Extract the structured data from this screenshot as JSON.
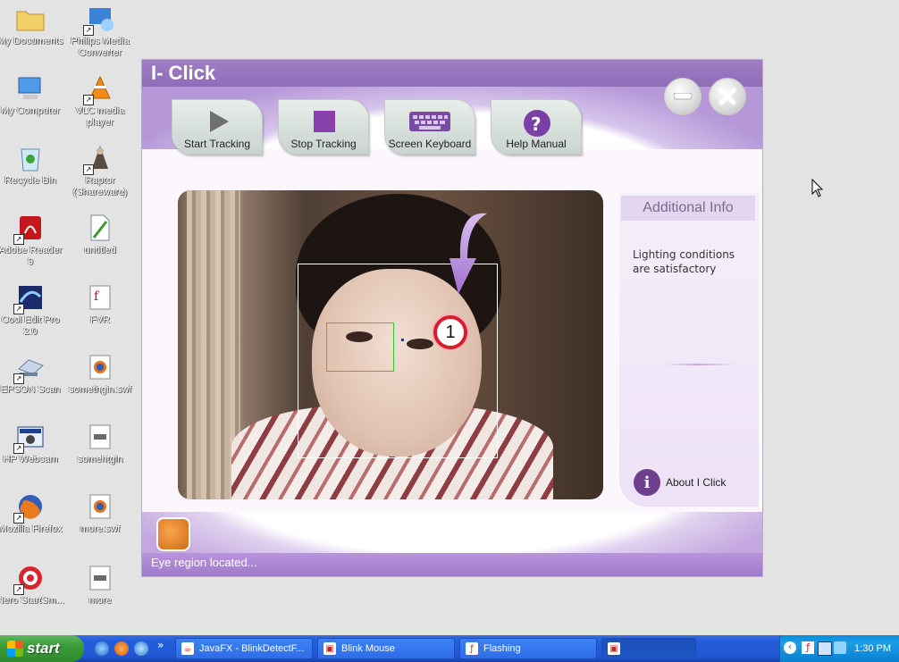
{
  "desktop": {
    "icons": [
      {
        "label": "My Documents",
        "icon": "folder-icon"
      },
      {
        "label": "Philips Media Converter",
        "icon": "media-converter-icon"
      },
      {
        "label": "My Computer",
        "icon": "computer-icon"
      },
      {
        "label": "VLC media player",
        "icon": "vlc-cone-icon"
      },
      {
        "label": "Recycle Bin",
        "icon": "recycle-bin-icon"
      },
      {
        "label": "Raptor (Shareware)",
        "icon": "raptor-icon"
      },
      {
        "label": "Adobe Reader 9",
        "icon": "adobe-reader-icon"
      },
      {
        "label": "untitled",
        "icon": "document-icon"
      },
      {
        "label": "Cool Edit Pro 2.0",
        "icon": "cool-edit-icon"
      },
      {
        "label": "FVR",
        "icon": "fvr-icon"
      },
      {
        "label": "EPSON Scan",
        "icon": "scanner-icon"
      },
      {
        "label": "somethgin.swf",
        "icon": "firefox-file-icon"
      },
      {
        "label": "HP Webcam",
        "icon": "webcam-icon"
      },
      {
        "label": "somehtgin",
        "icon": "html-file-icon"
      },
      {
        "label": "Mozilla Firefox",
        "icon": "firefox-icon"
      },
      {
        "label": "more.swf",
        "icon": "firefox-file-icon"
      },
      {
        "label": "Nero StartSm...",
        "icon": "nero-icon"
      },
      {
        "label": "more",
        "icon": "html-file-icon"
      }
    ]
  },
  "app": {
    "title": "I- Click",
    "toolbar": {
      "start": "Start Tracking",
      "stop": "Stop Tracking",
      "keyboard": "Screen Keyboard",
      "help": "Help Manual"
    },
    "video": {
      "marker_label": "1"
    },
    "info": {
      "title": "Additional Info",
      "message": "Lighting conditions are satisfactory",
      "about_label": "About I Click",
      "about_icon_glyph": "i"
    },
    "status": "Eye region located...",
    "colors": {
      "accent": "#9b78c4",
      "marker_ring": "#d61f2a",
      "eye_box": "#2bd02b"
    }
  },
  "taskbar": {
    "start_label": "start",
    "windows": [
      {
        "label": "JavaFX - BlinkDetectF...",
        "icon": "java-icon"
      },
      {
        "label": "Blink Mouse",
        "icon": "app-icon"
      },
      {
        "label": "Flashing",
        "icon": "flash-icon"
      },
      {
        "label": "",
        "icon": "app-icon"
      }
    ],
    "clock": "1:30 PM"
  }
}
